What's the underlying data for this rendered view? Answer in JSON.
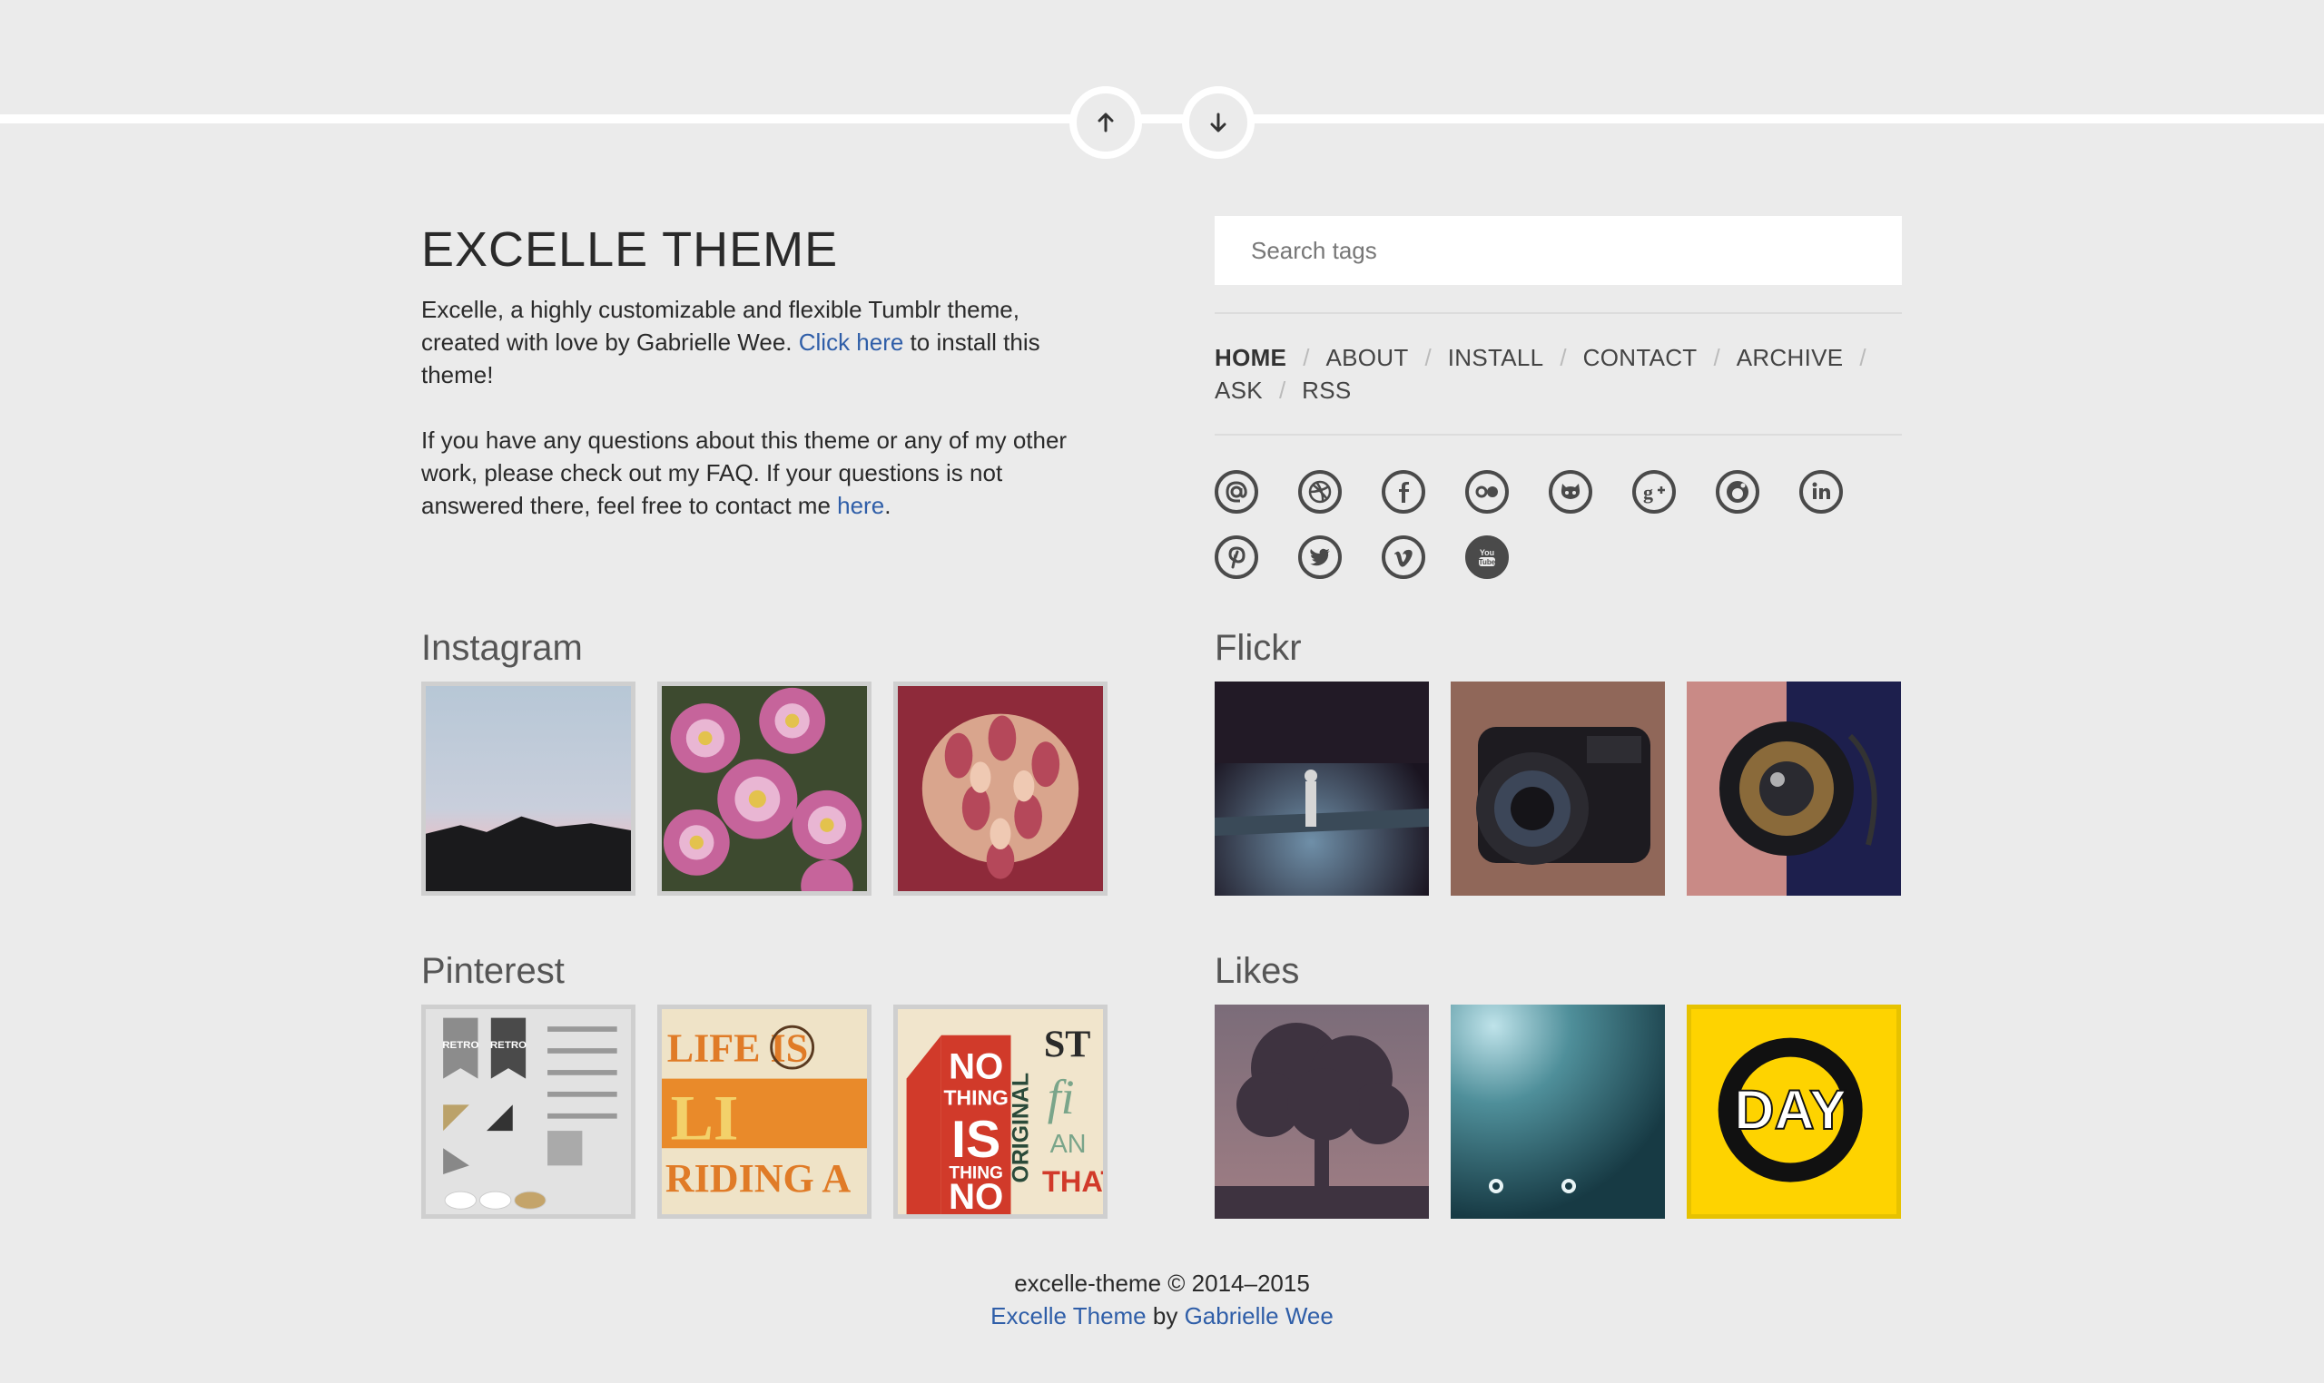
{
  "nav": {
    "up_icon": "arrow-up-icon",
    "down_icon": "arrow-down-icon"
  },
  "site": {
    "title": "EXCELLE THEME",
    "desc1_a": "Excelle, a highly customizable and flexible Tumblr theme, created with love by Gabrielle Wee. ",
    "desc1_link": "Click here",
    "desc1_b": " to install this theme!",
    "desc2_a": "If you have any questions about this theme or any of my other work, please check out my FAQ. If your questions is not answered there, feel free to contact me ",
    "desc2_link": "here",
    "desc2_b": "."
  },
  "search": {
    "placeholder": "Search tags"
  },
  "menu": {
    "items": [
      "HOME",
      "ABOUT",
      "INSTALL",
      "CONTACT",
      "ARCHIVE",
      "ASK",
      "RSS"
    ],
    "active": "HOME",
    "separator": "/"
  },
  "social_icons": [
    "email-icon",
    "dribbble-icon",
    "facebook-icon",
    "flickr-icon",
    "github-icon",
    "google-plus-icon",
    "reddit-icon",
    "linkedin-icon",
    "pinterest-icon",
    "twitter-icon",
    "vimeo-icon",
    "youtube-icon"
  ],
  "sections": {
    "instagram": "Instagram",
    "flickr": "Flickr",
    "pinterest": "Pinterest",
    "likes": "Likes"
  },
  "pinterest_thumbs": {
    "p1_a": "RETRO",
    "p1_b": "RETRO",
    "p2_a": "LIFE IS",
    "p2_b": "LI",
    "p2_c": "RIDING A",
    "p3_a": "NO",
    "p3_b": "THING",
    "p3_c": "IS",
    "p3_d": "NO",
    "p3_e": "THING",
    "p3_f": "ORIGINAL",
    "p3_g": "ST",
    "p3_h": "fi",
    "p3_i": "AN",
    "p3_j": "THAT"
  },
  "likes_thumbs": {
    "l3": "DAY"
  },
  "footer": {
    "line1": "excelle-theme © 2014–2015",
    "link1": "Excelle Theme",
    "by": " by ",
    "link2": "Gabrielle Wee"
  }
}
